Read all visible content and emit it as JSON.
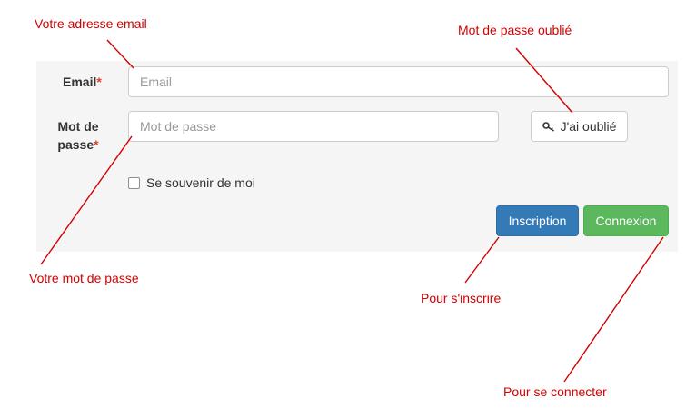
{
  "form": {
    "email_label": "Email",
    "email_required": "*",
    "email_placeholder": "Email",
    "password_label_line1": "Mot de",
    "password_label_line2": "passe",
    "password_required": "*",
    "password_placeholder": "Mot de passe",
    "forgot_label": "J'ai oublié",
    "remember_label": "Se souvenir de moi",
    "remember_checked": false,
    "register_label": "Inscription",
    "login_label": "Connexion"
  },
  "annotations": {
    "email": "Votre adresse email",
    "forgot": "Mot de passe oublié",
    "password": "Votre mot de passe",
    "register": "Pour s'inscrire",
    "login": "Pour se connecter"
  },
  "colors": {
    "annotation": "#d40000",
    "primary": "#337ab7",
    "success": "#5cb85c",
    "required": "#e33b2e",
    "panel": "#f5f5f5"
  },
  "icons": {
    "forgot": "key-icon"
  }
}
